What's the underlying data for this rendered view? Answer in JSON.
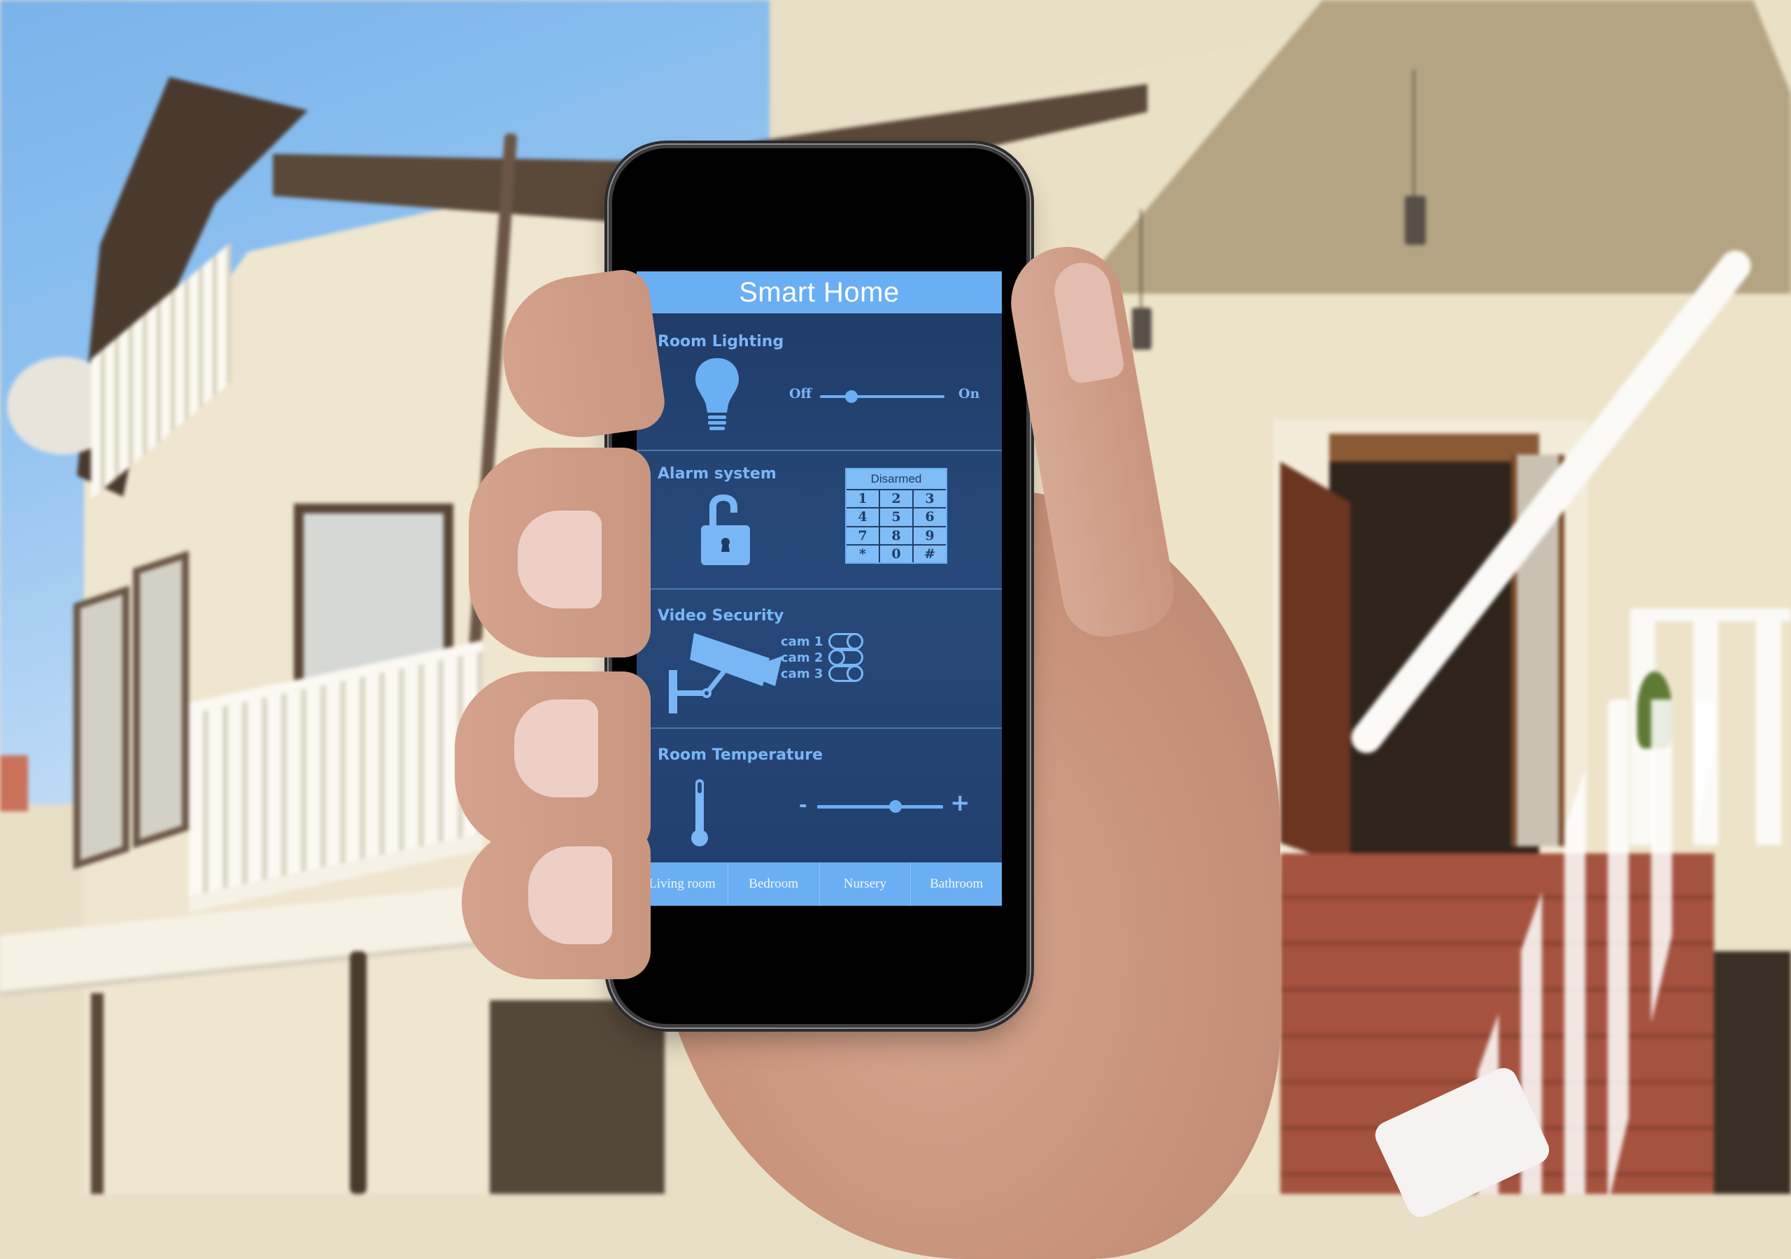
{
  "app": {
    "title": "Smart Home"
  },
  "colors": {
    "header_bg": "#6aaff3",
    "screen_bg": "#244578",
    "accent": "#79b6f5",
    "keypad_key": "#80bdf6"
  },
  "sections": {
    "lighting": {
      "title": "Room Lighting",
      "icon": "lightbulb-icon",
      "slider": {
        "min_label": "Off",
        "max_label": "On",
        "value_fraction": 0.25
      }
    },
    "alarm": {
      "title": "Alarm system",
      "icon": "unlocked-padlock-icon",
      "status": "Disarmed",
      "keys": [
        "1",
        "2",
        "3",
        "4",
        "5",
        "6",
        "7",
        "8",
        "9",
        "*",
        "0",
        "#"
      ]
    },
    "video": {
      "title": "Video Security",
      "icon": "security-camera-icon",
      "cameras": [
        {
          "label": "cam 1",
          "on": true
        },
        {
          "label": "cam 2",
          "on": false
        },
        {
          "label": "cam 3",
          "on": true
        }
      ]
    },
    "temperature": {
      "title": "Room Temperature",
      "icon": "thermometer-icon",
      "minus_label": "-",
      "plus_label": "+",
      "slider": {
        "value_fraction": 0.62
      }
    }
  },
  "tabs": [
    {
      "label": "Living room"
    },
    {
      "label": "Bedroom"
    },
    {
      "label": "Nursery"
    },
    {
      "label": "Bathroom"
    }
  ]
}
